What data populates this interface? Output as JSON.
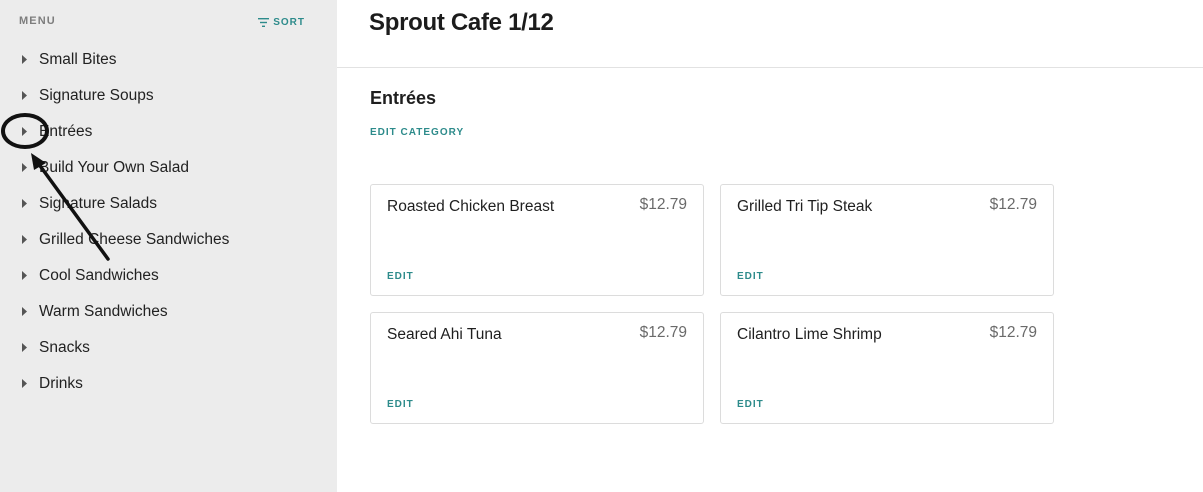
{
  "sidebar": {
    "header_label": "MENU",
    "sort_label": "SORT",
    "categories": [
      {
        "label": "Small Bites"
      },
      {
        "label": "Signature Soups"
      },
      {
        "label": "Entrées"
      },
      {
        "label": "Build Your Own Salad"
      },
      {
        "label": "Signature Salads"
      },
      {
        "label": "Grilled Cheese Sandwiches"
      },
      {
        "label": "Cool Sandwiches"
      },
      {
        "label": "Warm Sandwiches"
      },
      {
        "label": "Snacks"
      },
      {
        "label": "Drinks"
      }
    ]
  },
  "main": {
    "title": "Sprout Cafe 1/12",
    "category_name": "Entrées",
    "edit_category_label": "EDIT CATEGORY",
    "items": [
      {
        "name": "Roasted Chicken Breast",
        "price": "$12.79",
        "edit_label": "EDIT"
      },
      {
        "name": "Grilled Tri Tip Steak",
        "price": "$12.79",
        "edit_label": "EDIT"
      },
      {
        "name": "Seared Ahi Tuna",
        "price": "$12.79",
        "edit_label": "EDIT"
      },
      {
        "name": "Cilantro Lime Shrimp",
        "price": "$12.79",
        "edit_label": "EDIT"
      }
    ]
  },
  "colors": {
    "accent": "#2d8b8b",
    "sidebar_bg": "#ececec",
    "annotation": "#111111"
  }
}
